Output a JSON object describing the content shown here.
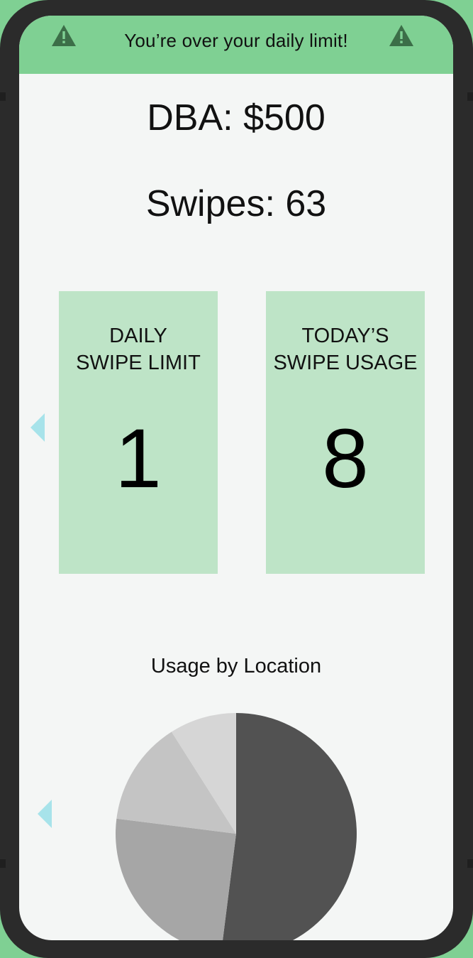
{
  "banner": {
    "message": "You’re over your daily limit!",
    "left_icon": "warning-icon",
    "right_icon": "warning-icon",
    "color": "#7fd093"
  },
  "summary": {
    "dba_text": "DBA: $500",
    "swipes_text": "Swipes: 63"
  },
  "cards": [
    {
      "title": "DAILY SWIPE LIMIT",
      "value": "1"
    },
    {
      "title": "TODAY’S SWIPE USAGE",
      "value": "8"
    }
  ],
  "nav": {
    "cards_prev_icon": "arrow-left-icon",
    "chart_prev_icon": "arrow-left-icon",
    "arrow_color": "#a7e3ea"
  },
  "chart_data": {
    "type": "pie",
    "title": "Usage by Location",
    "values": [
      52,
      25,
      14,
      9
    ],
    "colors": [
      "#525252",
      "#a6a6a6",
      "#c4c4c4",
      "#d6d6d6"
    ]
  }
}
